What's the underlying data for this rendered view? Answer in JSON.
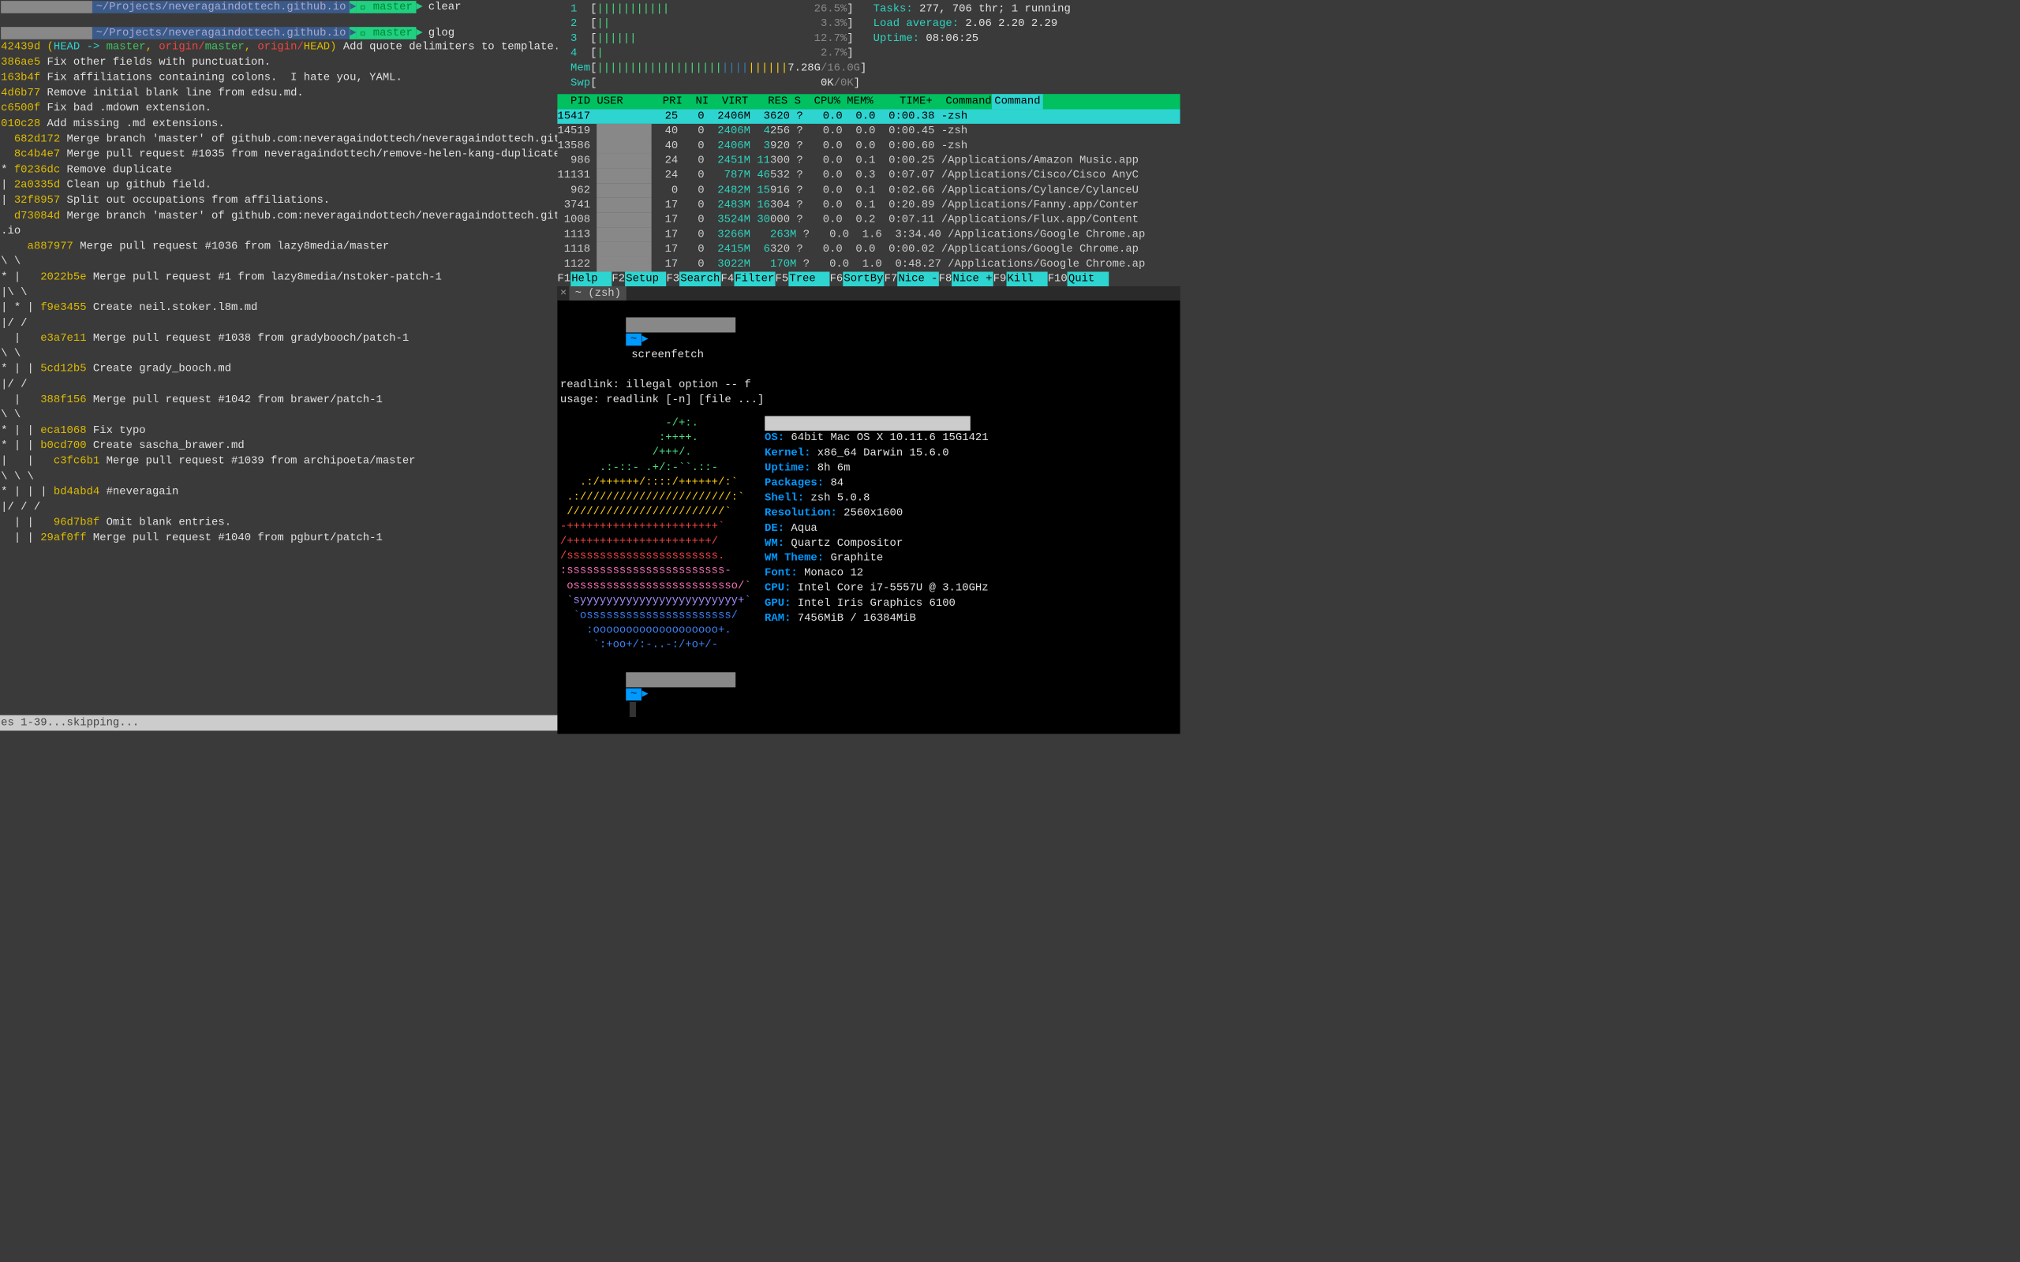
{
  "left": {
    "prompt1": {
      "path": "~/Projects/neveragaindottech.github.io",
      "branch": "master",
      "cmd": "clear"
    },
    "prompt2": {
      "path": "~/Projects/neveragaindottech.github.io",
      "branch": "master",
      "cmd": "glog"
    },
    "log": [
      {
        "g": "",
        "h": "42439d",
        "r": "(HEAD -> master, origin/master, origin/HEAD)",
        "m": " Add quote delimiters to template."
      },
      {
        "g": "",
        "h": "386ae5",
        "r": "",
        "m": " Fix other fields with punctuation."
      },
      {
        "g": "",
        "h": "163b4f",
        "r": "",
        "m": " Fix affiliations containing colons.  I hate you, YAML."
      },
      {
        "g": "",
        "h": "4d6b77",
        "r": "",
        "m": " Remove initial blank line from edsu.md."
      },
      {
        "g": "",
        "h": "c6500f",
        "r": "",
        "m": " Fix bad .mdown extension."
      },
      {
        "g": "",
        "h": "010c28",
        "r": "",
        "m": " Add missing .md extensions."
      },
      {
        "g": "  ",
        "h": "682d172",
        "r": "",
        "m": " Merge branch 'master' of github.com:neveragaindottech/neveragaindottech.githu"
      },
      {
        "g": "",
        "h": "",
        "r": "",
        "m": ""
      },
      {
        "g": "  ",
        "h": "8c4b4e7",
        "r": "",
        "m": " Merge pull request #1035 from neveragaindottech/remove-helen-kang-duplicate"
      },
      {
        "g": "",
        "h": "",
        "r": "",
        "m": ""
      },
      {
        "g": "* ",
        "h": "f0236dc",
        "r": "",
        "m": " Remove duplicate"
      },
      {
        "g": "| ",
        "h": "2a0335d",
        "r": "",
        "m": " Clean up github field."
      },
      {
        "g": "| ",
        "h": "32f8957",
        "r": "",
        "m": " Split out occupations from affiliations."
      },
      {
        "g": "",
        "h": "",
        "r": "",
        "m": ""
      },
      {
        "g": "  ",
        "h": "d73084d",
        "r": "",
        "m": " Merge branch 'master' of github.com:neveragaindottech/neveragaindottech.git"
      },
      {
        "g": ".io",
        "h": "",
        "r": "",
        "m": ""
      },
      {
        "g": "",
        "h": "",
        "r": "",
        "m": ""
      },
      {
        "g": "    ",
        "h": "a887977",
        "r": "",
        "m": " Merge pull request #1036 from lazy8media/master"
      },
      {
        "g": "\\ \\",
        "h": "",
        "r": "",
        "m": ""
      },
      {
        "g": "* |   ",
        "h": "2022b5e",
        "r": "",
        "m": " Merge pull request #1 from lazy8media/nstoker-patch-1"
      },
      {
        "g": "|\\ \\",
        "h": "",
        "r": "",
        "m": ""
      },
      {
        "g": "| * | ",
        "h": "f9e3455",
        "r": "",
        "m": " Create neil.stoker.l8m.md"
      },
      {
        "g": "|/ /",
        "h": "",
        "r": "",
        "m": ""
      },
      {
        "g": "  |   ",
        "h": "e3a7e11",
        "r": "",
        "m": " Merge pull request #1038 from gradybooch/patch-1"
      },
      {
        "g": "\\ \\",
        "h": "",
        "r": "",
        "m": ""
      },
      {
        "g": "* | | ",
        "h": "5cd12b5",
        "r": "",
        "m": " Create grady_booch.md"
      },
      {
        "g": "|/ /",
        "h": "",
        "r": "",
        "m": ""
      },
      {
        "g": "  |   ",
        "h": "388f156",
        "r": "",
        "m": " Merge pull request #1042 from brawer/patch-1"
      },
      {
        "g": "\\ \\",
        "h": "",
        "r": "",
        "m": ""
      },
      {
        "g": "* | | ",
        "h": "eca1068",
        "r": "",
        "m": " Fix typo"
      },
      {
        "g": "* | | ",
        "h": "b0cd700",
        "r": "",
        "m": " Create sascha_brawer.md"
      },
      {
        "g": "|   |   ",
        "h": "c3fc6b1",
        "r": "",
        "m": " Merge pull request #1039 from archipoeta/master"
      },
      {
        "g": "\\ \\ \\",
        "h": "",
        "r": "",
        "m": ""
      },
      {
        "g": "* | | | ",
        "h": "bd4abd4",
        "r": "",
        "m": " #neveragain"
      },
      {
        "g": "|/ / /",
        "h": "",
        "r": "",
        "m": ""
      },
      {
        "g": "",
        "h": "",
        "r": "",
        "m": ""
      },
      {
        "g": "  | |   ",
        "h": "96d7b8f",
        "r": "",
        "m": " Omit blank entries."
      },
      {
        "g": "",
        "h": "",
        "r": "",
        "m": ""
      },
      {
        "g": "  | | ",
        "h": "29af0ff",
        "r": "",
        "m": " Merge pull request #1040 from pgburt/patch-1"
      },
      {
        "g": "",
        "h": "",
        "r": "",
        "m": ""
      }
    ],
    "footer": "es 1-39...skipping..."
  },
  "htop": {
    "cpus": [
      {
        "n": "1",
        "bar": "|||||||||||",
        "pct": "26.5%"
      },
      {
        "n": "2",
        "bar": "||",
        "pct": "3.3%"
      },
      {
        "n": "3",
        "bar": "||||||",
        "pct": "12.7%"
      },
      {
        "n": "4",
        "bar": "|",
        "pct": "2.7%"
      }
    ],
    "mem": {
      "label": "Mem",
      "bar": "|||||||||||||||||||||||||||||",
      "used": "7.28G",
      "total": "16.0G"
    },
    "swp": {
      "label": "Swp",
      "used": "0K",
      "total": "0K"
    },
    "tasks": {
      "label": "Tasks:",
      "val": "277, 706 thr; 1 running"
    },
    "load": {
      "label": "Load average:",
      "val": "2.06 2.20 2.29"
    },
    "uptime": {
      "label": "Uptime:",
      "val": "08:06:25"
    },
    "header": "  PID USER      PRI  NI  VIRT   RES S  CPU% MEM%    TIME+  Command",
    "procs": [
      {
        "pid": "15417",
        "user": "",
        "pri": "25",
        "ni": "0",
        "virt": "2406M",
        "res": "3620",
        "s": "?",
        "cpu": "0.0",
        "mem": "0.0",
        "time": "0:00.38",
        "cmd": "-zsh",
        "hl": true
      },
      {
        "pid": "14519",
        "user": "",
        "pri": "40",
        "ni": "0",
        "virt": "2406M",
        "res": "4256",
        "s": "?",
        "cpu": "0.0",
        "mem": "0.0",
        "time": "0:00.45",
        "cmd": "-zsh"
      },
      {
        "pid": "13586",
        "user": "",
        "pri": "40",
        "ni": "0",
        "virt": "2406M",
        "res": "3920",
        "s": "?",
        "cpu": "0.0",
        "mem": "0.0",
        "time": "0:00.60",
        "cmd": "-zsh"
      },
      {
        "pid": "986",
        "user": "",
        "pri": "24",
        "ni": "0",
        "virt": "2451M",
        "res": "11300",
        "s": "?",
        "cpu": "0.0",
        "mem": "0.1",
        "time": "0:00.25",
        "cmd": "/Applications/Amazon Music.app"
      },
      {
        "pid": "11131",
        "user": "",
        "pri": "24",
        "ni": "0",
        "virt": "787M",
        "res": "46532",
        "s": "?",
        "cpu": "0.0",
        "mem": "0.3",
        "time": "0:07.07",
        "cmd": "/Applications/Cisco/Cisco AnyC"
      },
      {
        "pid": "962",
        "user": "",
        "pri": "0",
        "ni": "0",
        "virt": "2482M",
        "res": "15916",
        "s": "?",
        "cpu": "0.0",
        "mem": "0.1",
        "time": "0:02.66",
        "cmd": "/Applications/Cylance/CylanceU"
      },
      {
        "pid": "3741",
        "user": "",
        "pri": "17",
        "ni": "0",
        "virt": "2483M",
        "res": "16304",
        "s": "?",
        "cpu": "0.0",
        "mem": "0.1",
        "time": "0:20.89",
        "cmd": "/Applications/Fanny.app/Conter"
      },
      {
        "pid": "1008",
        "user": "",
        "pri": "17",
        "ni": "0",
        "virt": "3524M",
        "res": "30000",
        "s": "?",
        "cpu": "0.0",
        "mem": "0.2",
        "time": "0:07.11",
        "cmd": "/Applications/Flux.app/Content"
      },
      {
        "pid": "1113",
        "user": "",
        "pri": "17",
        "ni": "0",
        "virt": "3266M",
        "res": "263M",
        "s": "?",
        "cpu": "0.0",
        "mem": "1.6",
        "time": "3:34.40",
        "cmd": "/Applications/Google Chrome.ap"
      },
      {
        "pid": "1118",
        "user": "",
        "pri": "17",
        "ni": "0",
        "virt": "2415M",
        "res": "6320",
        "s": "?",
        "cpu": "0.0",
        "mem": "0.0",
        "time": "0:00.02",
        "cmd": "/Applications/Google Chrome.ap"
      },
      {
        "pid": "1122",
        "user": "",
        "pri": "17",
        "ni": "0",
        "virt": "3022M",
        "res": "170M",
        "s": "?",
        "cpu": "0.0",
        "mem": "1.0",
        "time": "0:48.27",
        "cmd": "/Applications/Google Chrome.ap"
      }
    ],
    "fnkeys": [
      {
        "k": "F1",
        "l": "Help  "
      },
      {
        "k": "F2",
        "l": "Setup "
      },
      {
        "k": "F3",
        "l": "Search"
      },
      {
        "k": "F4",
        "l": "Filter"
      },
      {
        "k": "F5",
        "l": "Tree  "
      },
      {
        "k": "F6",
        "l": "SortBy"
      },
      {
        "k": "F7",
        "l": "Nice -"
      },
      {
        "k": "F8",
        "l": "Nice +"
      },
      {
        "k": "F9",
        "l": "Kill  "
      },
      {
        "k": "F10",
        "l": "Quit  "
      }
    ]
  },
  "zsh": {
    "tab": "~ (zsh)",
    "prompt_cmd": "screenfetch",
    "err1": "readlink: illegal option -- f",
    "err2": "usage: readlink [-n] [file ...]",
    "info": [
      {
        "k": "OS:",
        "v": " 64bit Mac OS X 10.11.6 15G1421"
      },
      {
        "k": "Kernel:",
        "v": " x86_64 Darwin 15.6.0"
      },
      {
        "k": "Uptime:",
        "v": " 8h 6m"
      },
      {
        "k": "Packages:",
        "v": " 84"
      },
      {
        "k": "Shell:",
        "v": " zsh 5.0.8"
      },
      {
        "k": "Resolution:",
        "v": " 2560x1600"
      },
      {
        "k": "DE:",
        "v": " Aqua"
      },
      {
        "k": "WM:",
        "v": " Quartz Compositor"
      },
      {
        "k": "WM Theme:",
        "v": " Graphite"
      },
      {
        "k": "Font:",
        "v": " Monaco 12"
      },
      {
        "k": "CPU:",
        "v": " Intel Core i7-5557U @ 3.10GHz"
      },
      {
        "k": "GPU:",
        "v": " Intel Iris Graphics 6100"
      },
      {
        "k": "RAM:",
        "v": " 7456MiB / 16384MiB"
      }
    ],
    "logo": [
      {
        "c": "#4ade80",
        "t": "                -/+:."
      },
      {
        "c": "#4ade80",
        "t": "               :++++."
      },
      {
        "c": "#4ade80",
        "t": "              /+++/."
      },
      {
        "c": "#4ade80",
        "t": "      .:-::- .+/:-``.::-"
      },
      {
        "c": "#facc15",
        "t": "   .:/++++++/::::/++++++/:`"
      },
      {
        "c": "#facc15",
        "t": " .:///////////////////////:`"
      },
      {
        "c": "#facc15",
        "t": " ////////////////////////`"
      },
      {
        "c": "#ef4444",
        "t": "-+++++++++++++++++++++++`"
      },
      {
        "c": "#ef4444",
        "t": "/++++++++++++++++++++++/"
      },
      {
        "c": "#ef4444",
        "t": "/sssssssssssssssssssssss."
      },
      {
        "c": "#f472b6",
        "t": ":ssssssssssssssssssssssss-"
      },
      {
        "c": "#f472b6",
        "t": " osssssssssssssssssssssssso/`"
      },
      {
        "c": "#a78bfa",
        "t": " `syyyyyyyyyyyyyyyyyyyyyyyy+`"
      },
      {
        "c": "#3b82f6",
        "t": "  `ossssssssssssssssssssss/"
      },
      {
        "c": "#3b82f6",
        "t": "    :ooooooooooooooooooo+."
      },
      {
        "c": "#3b82f6",
        "t": "     `:+oo+/:-..-:/+o+/-"
      }
    ]
  }
}
